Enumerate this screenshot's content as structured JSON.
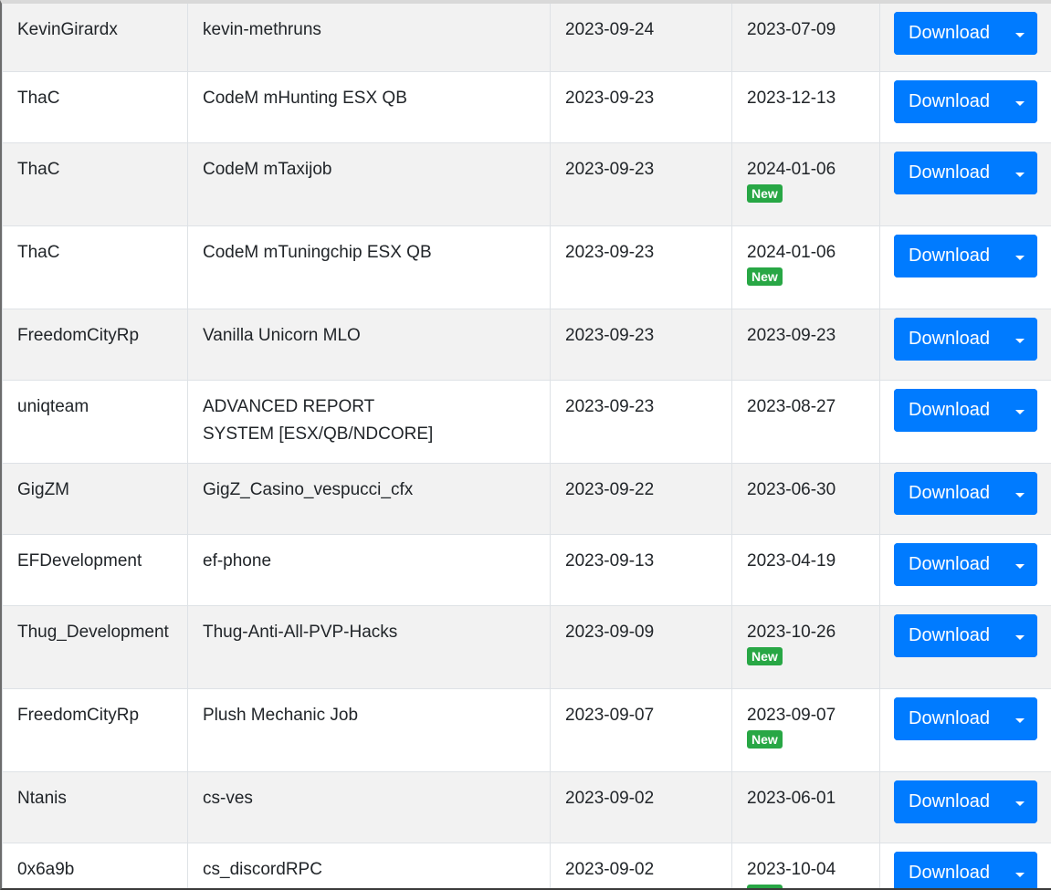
{
  "labels": {
    "download": "Download",
    "new_badge": "New"
  },
  "rows": [
    {
      "author": "KevinGirardx",
      "name": "kevin-methruns",
      "date_added": "2023-09-24",
      "date_updated": "2023-07-09",
      "is_new": false
    },
    {
      "author": "ThaC",
      "name": "CodeM mHunting ESX QB",
      "date_added": "2023-09-23",
      "date_updated": "2023-12-13",
      "is_new": false
    },
    {
      "author": "ThaC",
      "name": "CodeM mTaxijob",
      "date_added": "2023-09-23",
      "date_updated": "2024-01-06",
      "is_new": true
    },
    {
      "author": "ThaC",
      "name": "CodeM mTuningchip ESX QB",
      "date_added": "2023-09-23",
      "date_updated": "2024-01-06",
      "is_new": true
    },
    {
      "author": "FreedomCityRp",
      "name": "Vanilla Unicorn MLO",
      "date_added": "2023-09-23",
      "date_updated": "2023-09-23",
      "is_new": false
    },
    {
      "author": "uniqteam",
      "name": "ADVANCED REPORT SYSTEM [ESX/QB/NDCORE]",
      "date_added": "2023-09-23",
      "date_updated": "2023-08-27",
      "is_new": false
    },
    {
      "author": "GigZM",
      "name": "GigZ_Casino_vespucci_cfx",
      "date_added": "2023-09-22",
      "date_updated": "2023-06-30",
      "is_new": false
    },
    {
      "author": "EFDevelopment",
      "name": "ef-phone",
      "date_added": "2023-09-13",
      "date_updated": "2023-04-19",
      "is_new": false
    },
    {
      "author": "Thug_Development",
      "name": "Thug-Anti-All-PVP-Hacks",
      "date_added": "2023-09-09",
      "date_updated": "2023-10-26",
      "is_new": true
    },
    {
      "author": "FreedomCityRp",
      "name": "Plush Mechanic Job",
      "date_added": "2023-09-07",
      "date_updated": "2023-09-07",
      "is_new": true
    },
    {
      "author": "Ntanis",
      "name": "cs-ves",
      "date_added": "2023-09-02",
      "date_updated": "2023-06-01",
      "is_new": false
    },
    {
      "author": "0x6a9b",
      "name": "cs_discordRPC",
      "date_added": "2023-09-02",
      "date_updated": "2023-10-04",
      "is_new": true
    }
  ],
  "colors": {
    "primary": "#007bff",
    "success": "#28a745",
    "stripe": "#f2f2f2",
    "border": "#dee2e6"
  }
}
